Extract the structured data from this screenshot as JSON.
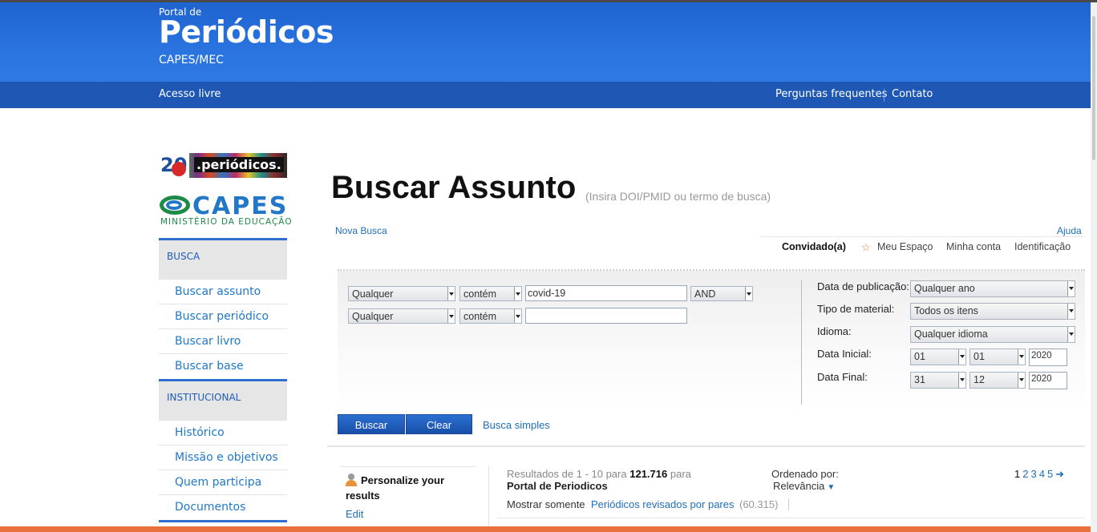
{
  "header": {
    "brand_small": "Portal de",
    "brand_big": "Periódicos",
    "brand_sub": "CAPES/MEC"
  },
  "navbar": {
    "acesso_livre": "Acesso livre",
    "perguntas": "Perguntas frequentes",
    "contato": "Contato"
  },
  "logos": {
    "periodicos20_number": "20",
    "periodicos20_text": ".periódicos.",
    "capes_word": "CAPES",
    "capes_ministry": "MINISTÉRIO DA EDUCAÇÃO"
  },
  "sidebar": {
    "busca_heading": "BUSCA",
    "busca_items": [
      "Buscar assunto",
      "Buscar periódico",
      "Buscar livro",
      "Buscar base"
    ],
    "inst_heading": "INSTITUCIONAL",
    "inst_items": [
      "Histórico",
      "Missão e objetivos",
      "Quem participa",
      "Documentos"
    ]
  },
  "main": {
    "title": "Buscar Assunto",
    "subtitle": "(Insira DOI/PMID ou termo de busca)",
    "nova_busca": "Nova Busca",
    "ajuda": "Ajuda"
  },
  "userbar": {
    "convidado": "Convidado(a)",
    "meu_espaco": "Meu Espaço",
    "minha_conta": "Minha conta",
    "identificacao": "Identificação"
  },
  "search": {
    "row1": {
      "field": "Qualquer",
      "operator": "contém",
      "value": "covid-19",
      "boolean": "AND"
    },
    "row2": {
      "field": "Qualquer",
      "operator": "contém",
      "value": ""
    }
  },
  "filters": {
    "data_pub_label": "Data de publicação:",
    "data_pub_value": "Qualquer ano",
    "tipo_label": "Tipo de material:",
    "tipo_value": "Todos os itens",
    "idioma_label": "Idioma:",
    "idioma_value": "Qualquer idioma",
    "data_inicial_label": "Data Inicial:",
    "data_inicial": {
      "day": "01",
      "month": "01",
      "year": "2020"
    },
    "data_final_label": "Data Final:",
    "data_final": {
      "day": "31",
      "month": "12",
      "year": "2020"
    }
  },
  "buttons": {
    "buscar": "Buscar",
    "clear": "Clear",
    "busca_simples": "Busca simples"
  },
  "results": {
    "personalize": "Personalize your results",
    "edit": "Edit",
    "prefix": "Resultados de 1 - 10 para",
    "total": "121.716",
    "para": "para",
    "source": "Portal de Periodicos",
    "ordenado_label": "Ordenado por:",
    "ordenado_value": "Relevância",
    "pages": [
      "1",
      "2",
      "3",
      "4",
      "5"
    ],
    "next_arrow": "➜",
    "mostrar": "Mostrar somente",
    "revisados": "Periódicos revisados por pares",
    "revisados_count": "(60.315)"
  },
  "colors": {
    "header_blue": "#2a74e0",
    "navbar_blue": "#1e58b4",
    "link_blue": "#1f6fb8",
    "accent_orange": "#e8703c"
  }
}
